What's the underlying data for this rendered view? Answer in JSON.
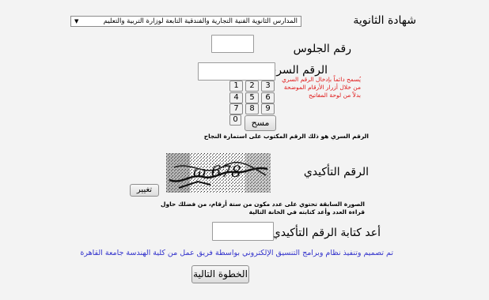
{
  "fields": {
    "school_label": "شهادة الثانوية",
    "school_selected": "المدارس الثانوية الفنية التجارية والفندقية التابعة لوزارة التربية والتعليم",
    "seat_label": "رقم الجلوس",
    "password_label": "الرقم السري",
    "confirm_label": "الرقم التأكيدي",
    "reenter_label": "أعد كتابة الرقم التأكيدي"
  },
  "notes": {
    "password_hint": "يُسمح دائماً بإدخال الرقم السري من خلال أزرار الأرقام الموضحة بدلاً من لوحة المفاتيح",
    "password_source": "الرقم السري هو ذلك الرقم المكتوب على استمارة النجاح",
    "captcha_hint": "الصورة السابقة تحتوي على عدد مكون من ستة أرقام، من فضلك حاول قراءة العدد وأعد كتابته في الخانة التالية",
    "credit": "تم تصميم وتنفيذ نظام وبرامج التنسيق الإلكتروني بواسطة فريق عمل من كلية الهندسة جامعة القاهرة"
  },
  "keypad": {
    "row1": [
      "3",
      "2",
      "1"
    ],
    "row2": [
      "6",
      "5",
      "4"
    ],
    "row3": [
      "9",
      "8",
      "7"
    ],
    "zero": "0",
    "clear": "مسح"
  },
  "captcha": {
    "change_button": "تغيير"
  },
  "buttons": {
    "next": "الخطوة التالية"
  },
  "icons": {
    "dropdown": "chevron-down-icon"
  }
}
